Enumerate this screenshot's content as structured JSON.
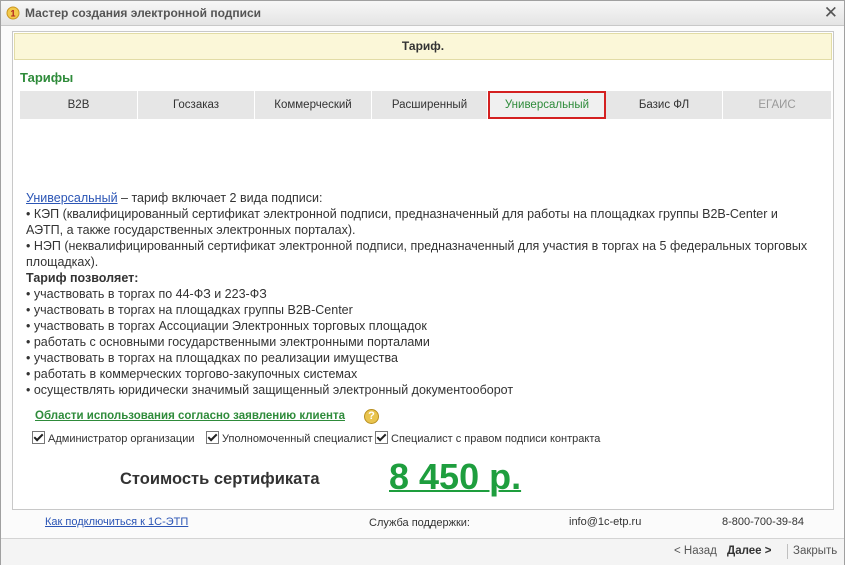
{
  "window": {
    "title": "Мастер создания электронной подписи",
    "close_symbol": "✕"
  },
  "banner": {
    "text": "Тариф."
  },
  "section": {
    "title": "Тарифы"
  },
  "tabs": [
    {
      "label": "B2B",
      "state": "normal"
    },
    {
      "label": "Госзаказ",
      "state": "normal"
    },
    {
      "label": "Коммерческий",
      "state": "normal"
    },
    {
      "label": "Расширенный",
      "state": "normal"
    },
    {
      "label": "Универсальный",
      "state": "active"
    },
    {
      "label": "Базис ФЛ",
      "state": "normal"
    },
    {
      "label": "ЕГАИС",
      "state": "disabled"
    }
  ],
  "description": {
    "link": "Универсальный",
    "intro": " – тариф включает 2 вида подписи:",
    "lines": [
      "• КЭП (квалифицированный сертификат электронной подписи, предназначенный для работы на площадках группы B2B-Center и АЭТП, а также государственных электронных порталах).",
      "• НЭП (неквалифицированный сертификат электронной подписи, предназначенный для участия в торгах на 5 федеральных торговых площадках)."
    ],
    "heading": "Тариф позволяет:",
    "bullets": [
      "• участвовать в торгах по 44-ФЗ и 223-ФЗ",
      "• участвовать в торгах на площадках группы B2B-Center",
      "• участвовать в торгах Ассоциации Электронных торговых площадок",
      "• работать с основными государственными электронными порталами",
      "• участвовать в торгах на площадках по реализации имущества",
      "• работать в коммерческих торгово-закупочных системах",
      "• осуществлять юридически значимый защищенный электронный документооборот"
    ]
  },
  "usage": {
    "title": "Области использования согласно заявлению клиента",
    "help": "?"
  },
  "checkboxes": [
    {
      "label": "Администратор организации",
      "checked": true
    },
    {
      "label": "Уполномоченный специалист",
      "checked": true
    },
    {
      "label": "Специалист с правом подписи контракта",
      "checked": true
    }
  ],
  "cost": {
    "label": "Стоимость сертификата",
    "value": "8 450 р."
  },
  "footer": {
    "connect_link": "Как подключиться к 1С-ЭТП",
    "support_label": "Служба поддержки:",
    "email": "info@1c-etp.ru",
    "phone": "8-800-700-39-84"
  },
  "nav": {
    "back": "< Назад",
    "next": "Далее >",
    "close": "Закрыть"
  },
  "colors": {
    "accent_green": "#2e8b3a",
    "price_green": "#1e9e3e",
    "active_tab_border": "#d42020",
    "link_blue": "#2b55b5"
  }
}
